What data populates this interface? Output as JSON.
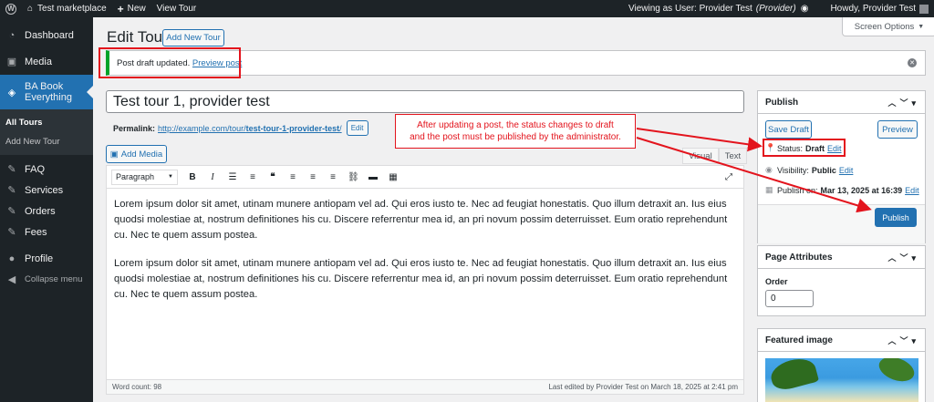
{
  "adminbar": {
    "site_name": "Test marketplace",
    "new_label": "New",
    "view_label": "View Tour",
    "viewing_as": "Viewing as User: Provider Test",
    "role": "(Provider)",
    "howdy": "Howdy, Provider Test"
  },
  "sidebar": {
    "items": [
      {
        "label": "Dashboard",
        "icon": "dashboard-icon"
      },
      {
        "label": "Media",
        "icon": "media-icon"
      },
      {
        "label": "BA Book Everything",
        "icon": "tag-icon"
      },
      {
        "label": "FAQ",
        "icon": "pin-icon"
      },
      {
        "label": "Services",
        "icon": "pin-icon"
      },
      {
        "label": "Orders",
        "icon": "pin-icon"
      },
      {
        "label": "Fees",
        "icon": "pin-icon"
      },
      {
        "label": "Profile",
        "icon": "user-icon"
      },
      {
        "label": "Collapse menu",
        "icon": "collapse-icon"
      }
    ],
    "submenu": [
      "All Tours",
      "Add New Tour"
    ]
  },
  "page": {
    "title": "Edit Tour",
    "add_new": "Add New Tour",
    "screen_options": "Screen Options"
  },
  "notice": {
    "text": "Post draft updated.",
    "link": "Preview post"
  },
  "post": {
    "title": "Test tour 1, provider test",
    "permalink_label": "Permalink:",
    "permalink_base": "http://example.com/tour/",
    "permalink_slug": "test-tour-1-provider-test",
    "permalink_end": "/",
    "edit_label": "Edit"
  },
  "editor": {
    "add_media": "Add Media",
    "tab_visual": "Visual",
    "tab_text": "Text",
    "format_select": "Paragraph",
    "paragraph1": "Lorem ipsum dolor sit amet, utinam munere antiopam vel ad. Qui eros iusto te. Nec ad feugiat honestatis. Quo illum detraxit an. Ius eius quodsi molestiae at, nostrum definitiones his cu. Discere referrentur mea id, an pri novum possim deterruisset. Eum oratio reprehendunt cu. Nec te quem assum postea.",
    "paragraph2": "Lorem ipsum dolor sit amet, utinam munere antiopam vel ad. Qui eros iusto te. Nec ad feugiat honestatis. Quo illum detraxit an. Ius eius quodsi molestiae at, nostrum definitiones his cu. Discere referrentur mea id, an pri novum possim deterruisset. Eum oratio reprehendunt cu. Nec te quem assum postea.",
    "word_count": "Word count: 98",
    "last_edited": "Last edited by Provider Test on March 18, 2025 at 2:41 pm"
  },
  "annotation": {
    "line1": "After updating a post, the status changes to draft",
    "line2": "and the post must be published by the administrator."
  },
  "publish": {
    "title": "Publish",
    "save_draft": "Save Draft",
    "preview": "Preview",
    "status_label": "Status:",
    "status_value": "Draft",
    "status_edit": "Edit",
    "visibility_label": "Visibility:",
    "visibility_value": "Public",
    "visibility_edit": "Edit",
    "publish_on_label": "Publish on:",
    "publish_on_value": "Mar 13, 2025 at 16:39",
    "publish_on_edit": "Edit",
    "publish_button": "Publish"
  },
  "page_attributes": {
    "title": "Page Attributes",
    "order_label": "Order",
    "order_value": "0"
  },
  "featured_image": {
    "title": "Featured image"
  },
  "colors": {
    "accent": "#2271b1",
    "admin_dark": "#1d2327",
    "annotation_red": "#e3141d",
    "success_green": "#00a32a"
  }
}
